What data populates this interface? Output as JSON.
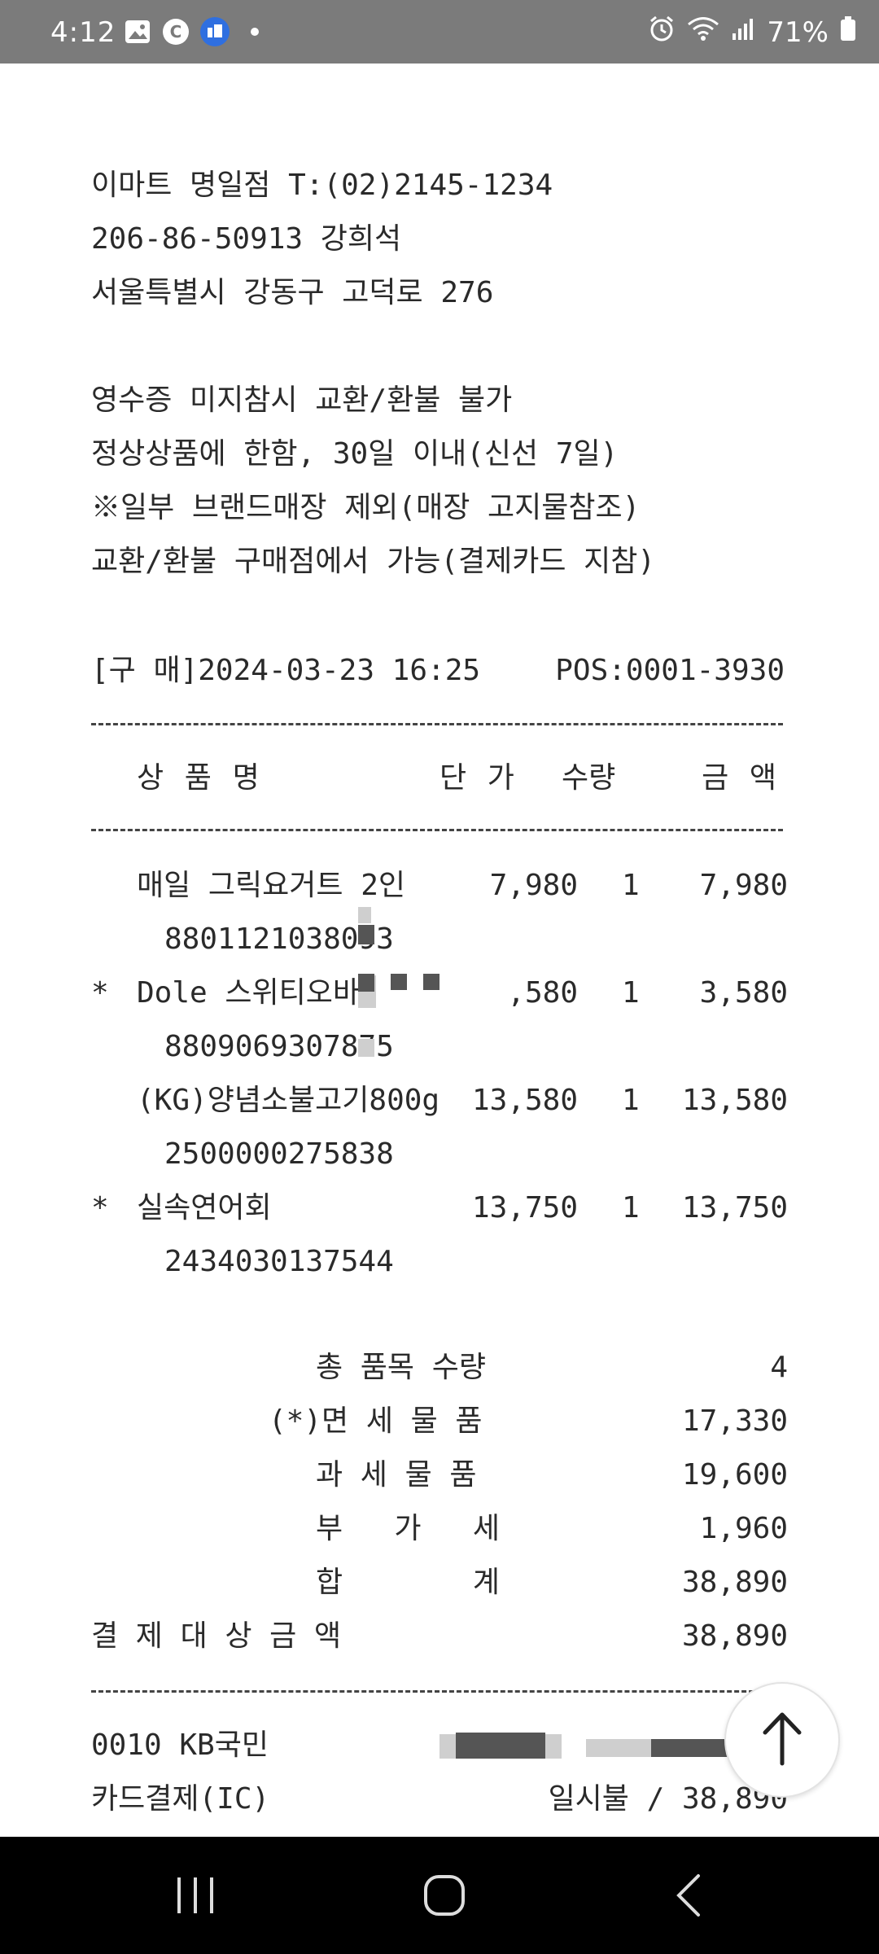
{
  "status_bar": {
    "time": "4:12",
    "battery": "71%"
  },
  "store": {
    "line1": "이마트 명일점 T:(02)2145-1234",
    "line2": "206-86-50913 강희석",
    "line3": "서울특별시 강동구 고덕로 276"
  },
  "policy": {
    "line1": "영수증 미지참시 교환/환불 불가",
    "line2": "정상상품에 한함, 30일 이내(신선 7일)",
    "line3": "※일부 브랜드매장 제외(매장 고지물참조)",
    "line4": "교환/환불 구매점에서 가능(결제카드 지참)"
  },
  "purchase": {
    "label": "[구 매]2024-03-23 16:25",
    "pos": "POS:0001-3930"
  },
  "headers": {
    "name": "상 품 명",
    "price": "단 가",
    "qty": "수량",
    "amount": "금 액"
  },
  "items": [
    {
      "mark": "",
      "name": "매일 그릭요거트 2인",
      "barcode": "8801121038093",
      "price": "7,980",
      "qty": "1",
      "amount": "7,980"
    },
    {
      "mark": "*",
      "name": "Dole 스위티오바",
      "barcode": "8809069307875",
      "price": ",580",
      "qty": "1",
      "amount": "3,580"
    },
    {
      "mark": "",
      "name": "(KG)양념소불고기800g",
      "barcode": "2500000275838",
      "price": "13,580",
      "qty": "1",
      "amount": "13,580"
    },
    {
      "mark": "*",
      "name": "실속연어회",
      "barcode": "2434030137544",
      "price": "13,750",
      "qty": "1",
      "amount": "13,750"
    }
  ],
  "summary": {
    "total_items_label": "총 품목 수량",
    "total_items": "4",
    "tax_free_label": "(*)면 세 물 품",
    "tax_free": "17,330",
    "taxable_label": "과 세 물 품",
    "taxable": "19,600",
    "vat_label": "부 가 세",
    "vat": "1,960",
    "sum_label": "합 계",
    "sum": "38,890",
    "payment_label": "결 제 대 상 금 액",
    "payment": "38,890"
  },
  "card": {
    "line1": "0010 KB국민",
    "line2": "카드결제(IC)",
    "installment": "일시불 / 38,890"
  }
}
